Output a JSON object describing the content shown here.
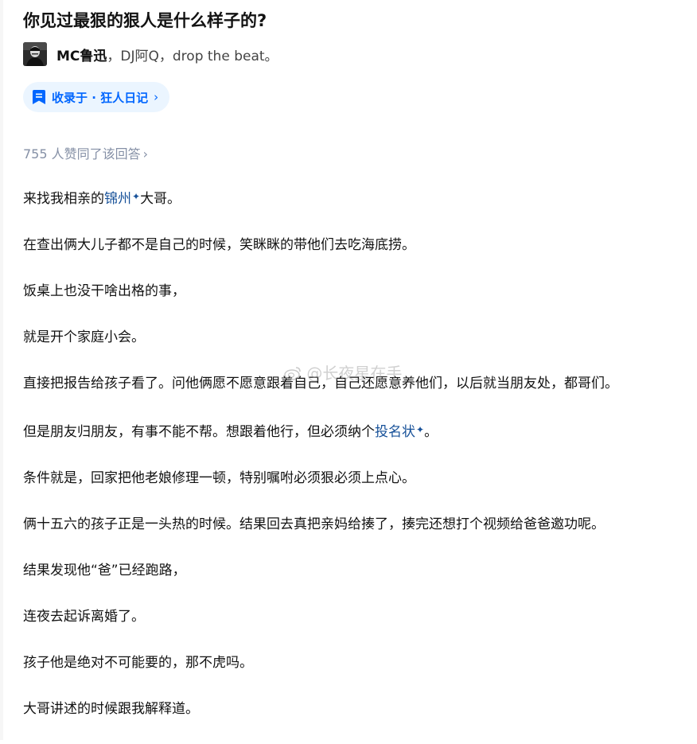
{
  "question": {
    "title": "你见过最狠的狠人是什么样子的?"
  },
  "author": {
    "name": "MC鲁迅",
    "separator": "，",
    "bio": "DJ阿Q，drop the beat。"
  },
  "collection": {
    "label": "收录于 · 狂人日记",
    "chevron": "›"
  },
  "votes": {
    "text": "755 人赞同了该回答",
    "chevron": "›"
  },
  "answer": {
    "p1": {
      "pre": "来找我相亲的",
      "link": "锦州",
      "post": "大哥。"
    },
    "p2": "在查出俩大儿子都不是自己的时候，笑眯眯的带他们去吃海底捞。",
    "p3": "饭桌上也没干啥出格的事，",
    "p4": "就是开个家庭小会。",
    "p5": "直接把报告给孩子看了。问他俩愿不愿意跟着自己，自己还愿意养他们，以后就当朋友处，都哥们。",
    "p6": {
      "pre": "但是朋友归朋友，有事不能不帮。想跟着他行，但必须纳个",
      "link": "投名状",
      "post": "。"
    },
    "p7": "条件就是，回家把他老娘修理一顿，特别嘱咐必须狠必须上点心。",
    "p8": "俩十五六的孩子正是一头热的时候。结果回去真把亲妈给揍了，揍完还想打个视频给爸爸邀功呢。",
    "p9": "结果发现他“爸”已经跑路，",
    "p10": "连夜去起诉离婚了。",
    "p11": "孩子他是绝对不可能要的，那不虎吗。",
    "p12": "大哥讲述的时候跟我解释道。"
  },
  "keyword_mark": "✦",
  "watermark": {
    "text": "@长夜星在手"
  },
  "icons": {
    "collection": "bookmark-icon",
    "keyword": "sparkle-icon",
    "watermark": "weibo-icon"
  },
  "colors": {
    "text": "#121212",
    "muted": "#8590a6",
    "link": "#175199",
    "accent": "#0066ff",
    "tag_bg": "#ebf5ff"
  }
}
